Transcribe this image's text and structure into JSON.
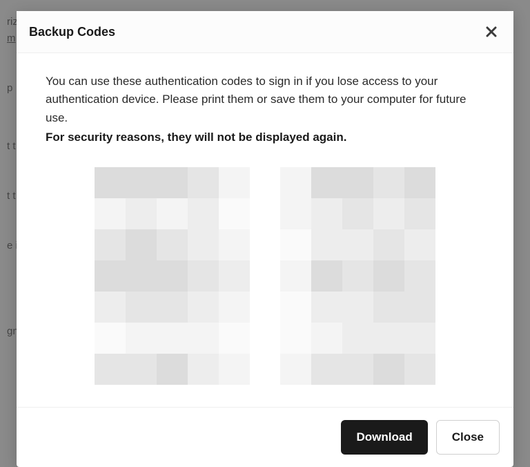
{
  "modal": {
    "title": "Backup Codes",
    "description": "You can use these authentication codes to sign in if you lose access to your authentication device. Please print them or save them to your computer for future use.",
    "warning": "For security reasons, they will not be displayed again."
  },
  "buttons": {
    "download": "Download",
    "close": "Close"
  },
  "codes": {
    "left": "obscured",
    "right": "obscured"
  },
  "background": {
    "line1": "riz",
    "line1b": "m",
    "line2": "p",
    "line3": "t t",
    "line4": "t t",
    "line5": "e i",
    "line6": "gn"
  }
}
